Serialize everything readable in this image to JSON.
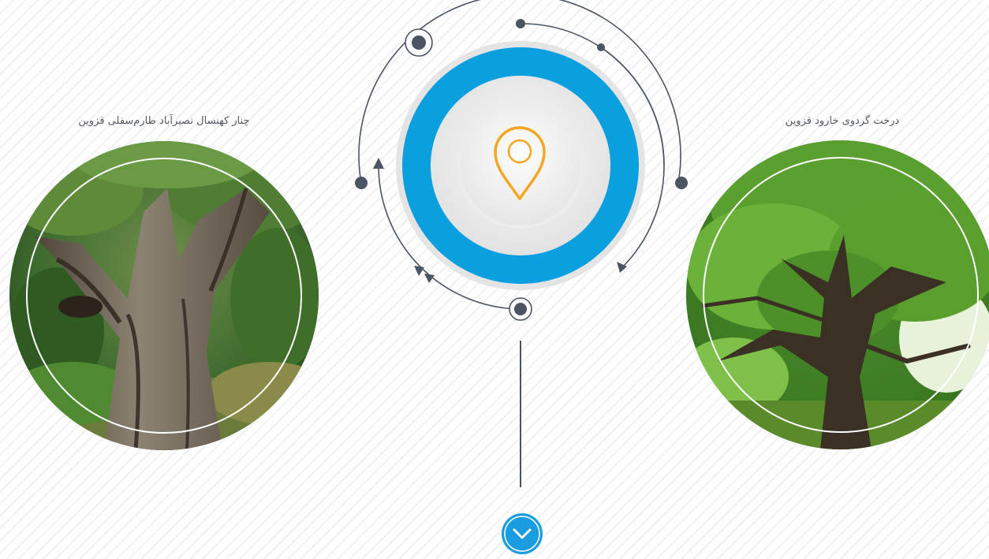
{
  "left_feature": {
    "caption": "چنار کهنسال نصیرآباد طارم‌سفلی قزوین",
    "image": "old-plane-tree-trunk-photo"
  },
  "right_feature": {
    "caption": "درخت گردوی خارود قزوین",
    "image": "walnut-tree-canopy-photo"
  },
  "hub": {
    "icon": "map-pin-icon",
    "colors": {
      "ring": "#0aa0e0",
      "pin": "#f5a623",
      "lines": "#4a5462"
    }
  },
  "scroll_button": {
    "icon": "chevron-down-icon",
    "color": "#1a9de0"
  }
}
